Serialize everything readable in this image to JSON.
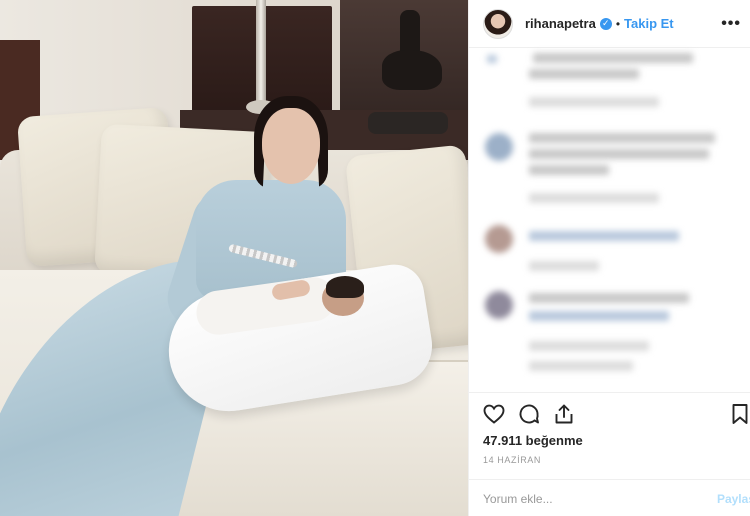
{
  "post": {
    "username": "rihanapetra",
    "follow_label": "Takip Et",
    "separator": "•",
    "more_label": "•••",
    "likes_text": "47.911 beğenme",
    "date_text": "14 HAZİRAN",
    "comment_placeholder": "Yorum ekle...",
    "share_label": "Paylaş"
  },
  "icons": {
    "verified": "verified-badge-icon",
    "like": "heart-icon",
    "comment": "comment-bubble-icon",
    "share": "share-icon",
    "save": "bookmark-icon"
  },
  "colors": {
    "accent": "#3897f0",
    "text": "#262626",
    "muted": "#999999",
    "share_disabled": "#b2dffc"
  }
}
